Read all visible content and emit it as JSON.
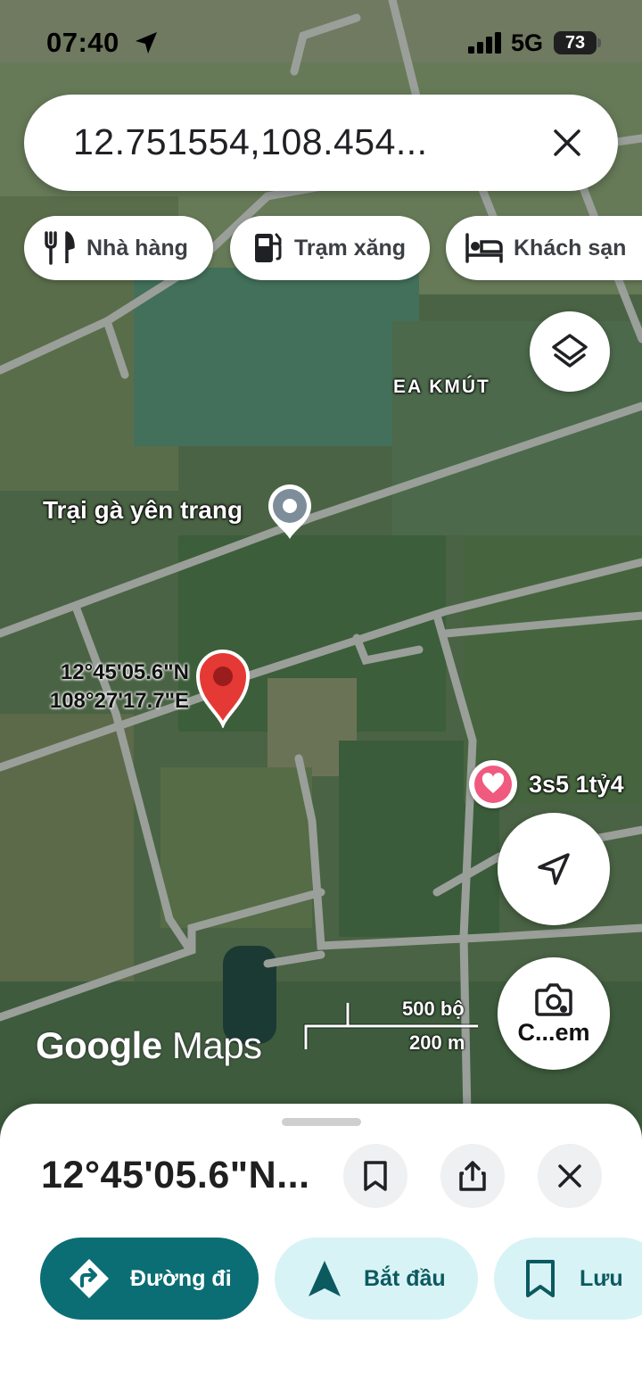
{
  "status_bar": {
    "time": "07:40",
    "network": "5G",
    "battery": "73"
  },
  "search": {
    "query": "12.751554,108.454..."
  },
  "chips": [
    {
      "label": "Nhà hàng",
      "icon": "restaurant-icon"
    },
    {
      "label": "Trạm xăng",
      "icon": "gas-station-icon"
    },
    {
      "label": "Khách sạn",
      "icon": "hotel-icon"
    }
  ],
  "map": {
    "area_label": "EA KMÚT",
    "place_label": "Trại gà yên trang",
    "saved_label": "3s5 1tỷ4",
    "pin_lat": "12°45'05.6\"N",
    "pin_lng": "108°27'17.7\"E",
    "scale_feet": "500 bộ",
    "scale_meters": "200 m",
    "logo_google": "Google",
    "logo_maps": "Maps",
    "camera_label": "C...em"
  },
  "sheet": {
    "title": "12°45'05.6\"N...",
    "directions_label": "Đường đi",
    "start_label": "Bắt đầu",
    "save_label": "Lưu"
  },
  "colors": {
    "accent": "#0b6e74",
    "pin": "#e53935",
    "pill_light": "#d8f3f6",
    "saved_heart": "#f05a7e"
  }
}
